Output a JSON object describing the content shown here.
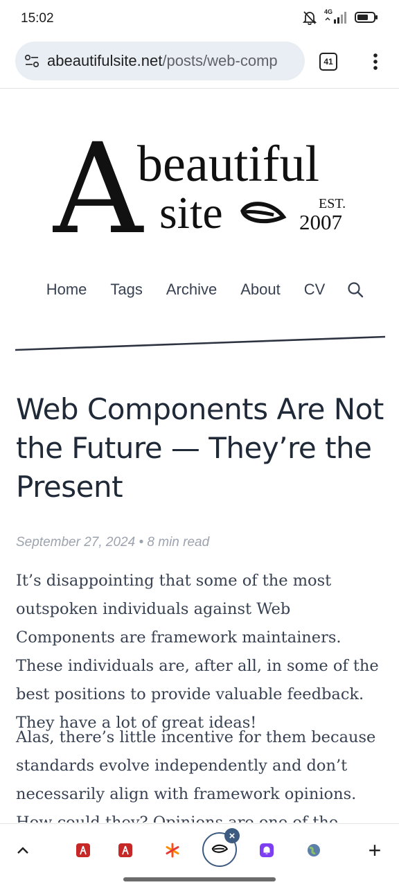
{
  "status": {
    "time": "15:02",
    "network": "4G",
    "icons": [
      "bell-off-icon",
      "signal-icon",
      "battery-icon"
    ]
  },
  "browser": {
    "url_domain": "abeautifulsite.net",
    "url_path": "/posts/web-comp",
    "tab_count": "41",
    "icons": [
      "site-info-icon",
      "tabs-icon",
      "more-menu-icon"
    ]
  },
  "logo": {
    "big_letter": "A",
    "line1": "beautiful",
    "line2": "site",
    "est": "EST.",
    "year": "2007"
  },
  "nav": {
    "items": [
      "Home",
      "Tags",
      "Archive",
      "About",
      "CV"
    ],
    "search_icon": "search-icon"
  },
  "article": {
    "title": "Web Components Are Not the Future — They’re the Present",
    "date": "September 27, 2024",
    "read_time": "8 min read",
    "separator": "•",
    "paragraphs": [
      "It’s disappointing that some of the most outspoken individuals against Web Components are framework maintainers. These individuals are, after all, in some of the best positions to provide valuable feedback. They have a lot of great ideas!",
      "Alas, there’s little incentive for them because standards evolve independently and don’t necessarily align with framework opinions. How could they? Opinions are one of the things that"
    ]
  },
  "bottom_bar": {
    "icons": [
      "chevron-up-icon",
      "tab-favicon",
      "tab-favicon",
      "tab-favicon",
      "active-tab-favicon",
      "tab-favicon",
      "tab-favicon",
      "new-tab-icon"
    ],
    "close_label": "×",
    "add_label": "+"
  },
  "colors": {
    "text": "#1f2937",
    "muted": "#9ca3af",
    "url_bg": "#e9eef4",
    "accent": "#3d5a80"
  }
}
